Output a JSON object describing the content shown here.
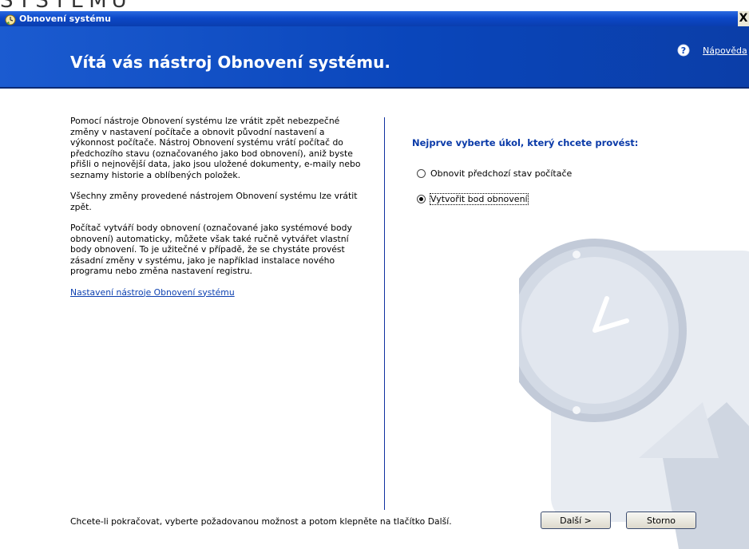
{
  "background_title": "SYSTÉMU",
  "window": {
    "title": "Obnovení systému",
    "close_label": "X"
  },
  "header": {
    "title": "Vítá vás nástroj Obnovení systému.",
    "help_link": "Nápověda"
  },
  "left": {
    "paragraphs": [
      "Pomocí nástroje Obnovení systému lze vrátit zpět nebezpečné změny v nastavení počítače a obnovit původní nastavení a výkonnost počítače. Nástroj Obnovení systému vrátí počítač do předchozího stavu (označovaného jako bod obnovení), aniž byste přišli o nejnovější data, jako jsou uložené dokumenty, e-maily nebo seznamy historie a oblíbených položek.",
      "Všechny změny provedené nástrojem Obnovení systému lze vrátit zpět.",
      "Počítač vytváří body obnovení (označované jako systémové body obnovení) automaticky, můžete však také ručně vytvářet vlastní body obnovení. To je užitečné v případě, že se chystáte provést zásadní změny v systému, jako je například instalace nového programu nebo změna nastavení registru."
    ],
    "settings_link": "Nastavení nástroje Obnovení systému"
  },
  "right": {
    "question": "Nejprve vyberte úkol, který chcete provést:",
    "options": [
      {
        "label": "Obnovit předchozí stav počítače",
        "selected": false
      },
      {
        "label": "Vytvořit bod obnovení",
        "selected": true
      }
    ]
  },
  "footer": {
    "instruction": "Chcete-li pokračovat, vyberte požadovanou možnost a potom klepněte na tlačítko Další.",
    "next_button": "Další >",
    "cancel_button": "Storno"
  },
  "colors": {
    "header_blue": "#0a46bb",
    "question_blue": "#0a3aa8",
    "link_blue": "#0b3fb0"
  }
}
